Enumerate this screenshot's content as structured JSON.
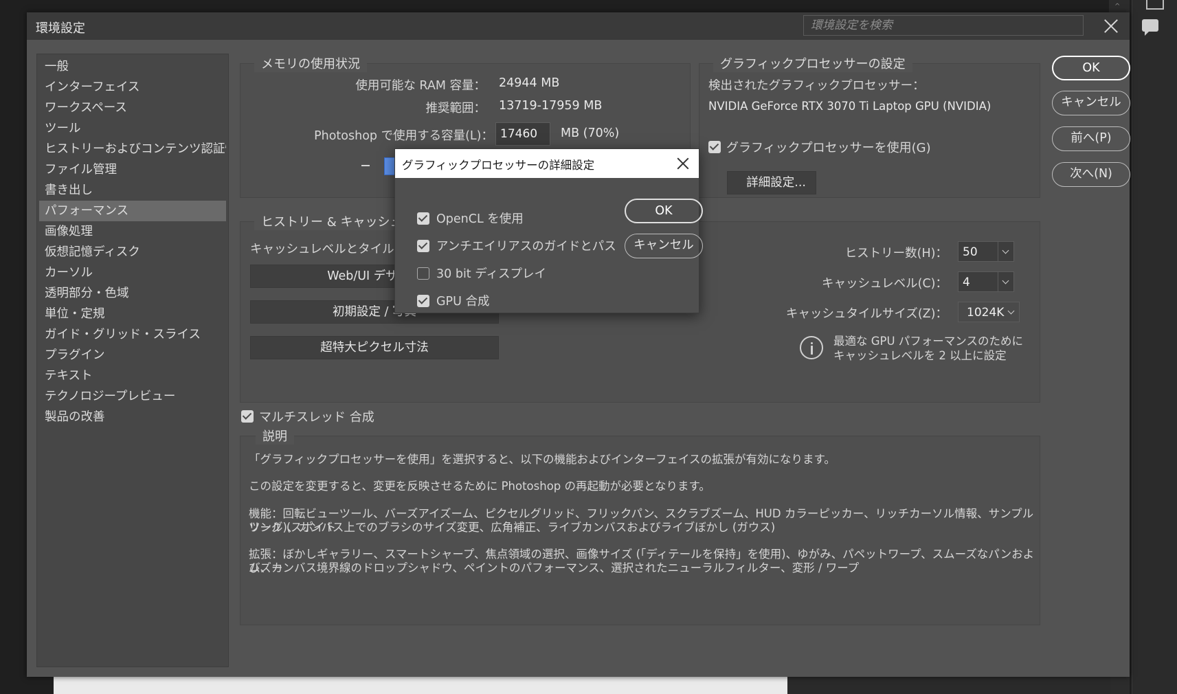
{
  "window": {
    "title": "環境設定",
    "search_placeholder": "環境設定を検索"
  },
  "sidebar": {
    "items": [
      {
        "label": "一般"
      },
      {
        "label": "インターフェイス"
      },
      {
        "label": "ワークスペース"
      },
      {
        "label": "ツール"
      },
      {
        "label": "ヒストリーおよびコンテンツ認証情報"
      },
      {
        "label": "ファイル管理"
      },
      {
        "label": "書き出し"
      },
      {
        "label": "パフォーマンス",
        "selected": true
      },
      {
        "label": "画像処理"
      },
      {
        "label": "仮想記憶ディスク"
      },
      {
        "label": "カーソル"
      },
      {
        "label": "透明部分・色域"
      },
      {
        "label": "単位・定規"
      },
      {
        "label": "ガイド・グリッド・スライス"
      },
      {
        "label": "プラグイン"
      },
      {
        "label": "テキスト"
      },
      {
        "label": "テクノロジープレビュー"
      },
      {
        "label": "製品の改善"
      }
    ]
  },
  "memory": {
    "legend": "メモリの使用状況",
    "ram_label": "使用可能な RAM 容量：",
    "ram_value": "24944 MB",
    "range_label": "推奨範囲：",
    "range_value": "13719-17959 MB",
    "usage_label": "Photoshop で使用する容量(L)：",
    "usage_value": "17460",
    "usage_suffix": "MB (70%)",
    "usage_percent": 70
  },
  "gpu": {
    "legend": "グラフィックプロセッサーの設定",
    "detected_label": "検出されたグラフィックプロセッサー：",
    "detected_value": "NVIDIA GeForce RTX 3070 Ti Laptop GPU (NVIDIA)",
    "use_label": "グラフィックプロセッサーを使用(G)",
    "use_checked": true,
    "advanced_button": "詳細設定..."
  },
  "history": {
    "legend": "ヒストリー & キャッシュ",
    "cache_desc": "キャッシュレベルとタイルサイズの",
    "btn_web": "Web/UI デザイン",
    "btn_default": "初期設定 / 写真",
    "btn_huge": "超特大ピクセル寸法",
    "states_label": "ヒストリー数(H)：",
    "states_value": "50",
    "cache_level_label": "キャッシュレベル(C)：",
    "cache_level_value": "4",
    "tile_label": "キャッシュタイルサイズ(Z)：",
    "tile_value": "1024K",
    "info_line1": "最適な GPU パフォーマンスのために",
    "info_line2": "キャッシュレベルを 2 以上に設定"
  },
  "multithread": {
    "label": "マルチスレッド 合成",
    "checked": true
  },
  "description": {
    "legend": "説明",
    "p1": "「グラフィックプロセッサーを使用」を選択すると、以下の機能およびインターフェイスの拡張が有効になります。",
    "p2": "この設定を変更すると、変更を反映させるために Photoshop の再起動が必要となります。",
    "p3a": "機能：回転ビューツール、バーズアイズーム、ピクセルグリッド、フリックパン、スクラブズーム、HUD カラーピッカー、リッチカーソル情報、サンプルリング (スポイト",
    "p3b": "ツール)、カンバス上でのブラシのサイズ変更、広角補正、ライブカンバスおよびライブぼかし (ガウス)",
    "p4a": "拡張：ぼかしギャラリー、スマートシャープ、焦点領域の選択、画像サイズ (「ディテールを保持」を使用)、ゆがみ、パペットワープ、スムーズなパンおよびズー",
    "p4b": "ム、カンバス境界線のドロップシャドウ、ペイントのパフォーマンス、選択されたニューラルフィルター、変形 / ワープ"
  },
  "buttons": {
    "ok": "OK",
    "cancel": "キャンセル",
    "prev": "前へ(P)",
    "next": "次へ(N)"
  },
  "modal": {
    "title": "グラフィックプロセッサーの詳細設定",
    "opencl": "OpenCL を使用",
    "antialias": "アンチエイリアスのガイドとパス",
    "bit30": "30 bit ディスプレイ",
    "gpu_composite": "GPU 合成",
    "ok": "OK",
    "cancel": "キャンセル"
  }
}
